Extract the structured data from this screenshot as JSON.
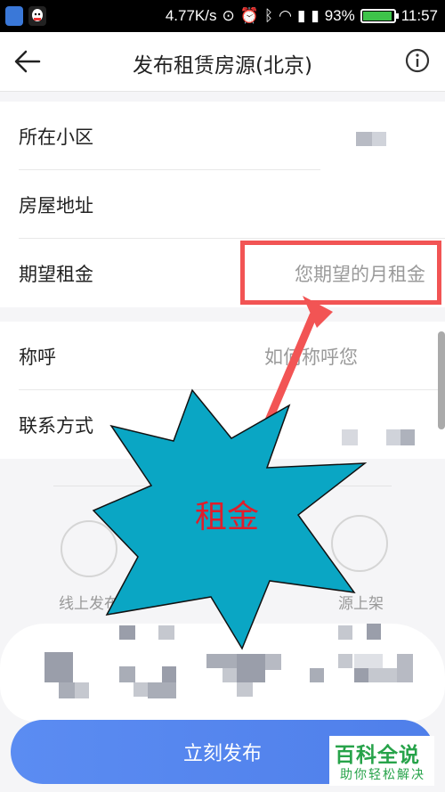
{
  "status_bar": {
    "network_speed": "4.77K/s",
    "battery": "93%",
    "battery_level": 0.93,
    "time": "11:57"
  },
  "header": {
    "title": "发布租赁房源(北京)",
    "back_icon": "arrow-left-icon",
    "info_icon": "info-circle-icon"
  },
  "form_section1": [
    {
      "label": "所在小区",
      "value": ""
    },
    {
      "label": "房屋地址",
      "value": ""
    },
    {
      "label": "期望租金",
      "placeholder": "您期望的月租金"
    }
  ],
  "form_section2": [
    {
      "label": "称呼",
      "placeholder": "如何称呼您"
    },
    {
      "label": "联系方式",
      "value": ""
    }
  ],
  "annotation": {
    "callout_text": "租金",
    "highlight_color": "#f25454",
    "callout_color": "#0aa6c4"
  },
  "bottom": {
    "left_caption": "线上发布",
    "right_caption": "源上架"
  },
  "publish_button": {
    "label": "立刻发布"
  },
  "watermark": {
    "title": "百科全说",
    "subtitle": "助你轻松解决"
  },
  "colors": {
    "accent": "#5b8cf2",
    "brand_green": "#27a34a"
  }
}
